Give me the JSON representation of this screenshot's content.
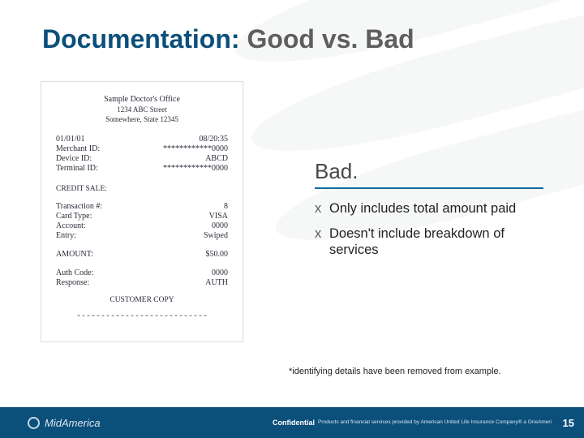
{
  "title": {
    "accent": "Documentation:",
    "rest": " Good vs. Bad"
  },
  "receipt": {
    "header": {
      "name": "Sample Doctor's Office",
      "addr1": "1234 ABC Street",
      "addr2": "Somewhere, State 12345"
    },
    "top_rows": [
      {
        "lbl": "01/01/01",
        "val": "08/20:35"
      },
      {
        "lbl": "Merchant ID:",
        "val": "************0000"
      },
      {
        "lbl": "Device ID:",
        "val": "ABCD"
      },
      {
        "lbl": "Terminal ID:",
        "val": "************0000"
      }
    ],
    "sale_label": "CREDIT SALE:",
    "sale_rows": [
      {
        "lbl": "Transaction #:",
        "val": "8"
      },
      {
        "lbl": "Card Type:",
        "val": "VISA"
      },
      {
        "lbl": "Account:",
        "val": "0000"
      },
      {
        "lbl": "Entry:",
        "val": "Swiped"
      }
    ],
    "amount_row": {
      "lbl": "AMOUNT:",
      "val": "$50.00"
    },
    "auth_rows": [
      {
        "lbl": "Auth Code:",
        "val": "0000"
      },
      {
        "lbl": "Response:",
        "val": "AUTH"
      }
    ],
    "copy_label": "CUSTOMER COPY",
    "dashes": "---------------------------"
  },
  "right": {
    "heading": "Bad.",
    "bullets": [
      "Only includes total amount paid",
      "Doesn't include breakdown of services"
    ],
    "x": "x"
  },
  "footnote": "*identifying details have been removed from example.",
  "footer": {
    "brand": "MidAmerica",
    "conf": "Confidential",
    "legal": "Products and financial services provided by American United Life Insurance Company®  a OneAmerica® company",
    "page": "15"
  }
}
